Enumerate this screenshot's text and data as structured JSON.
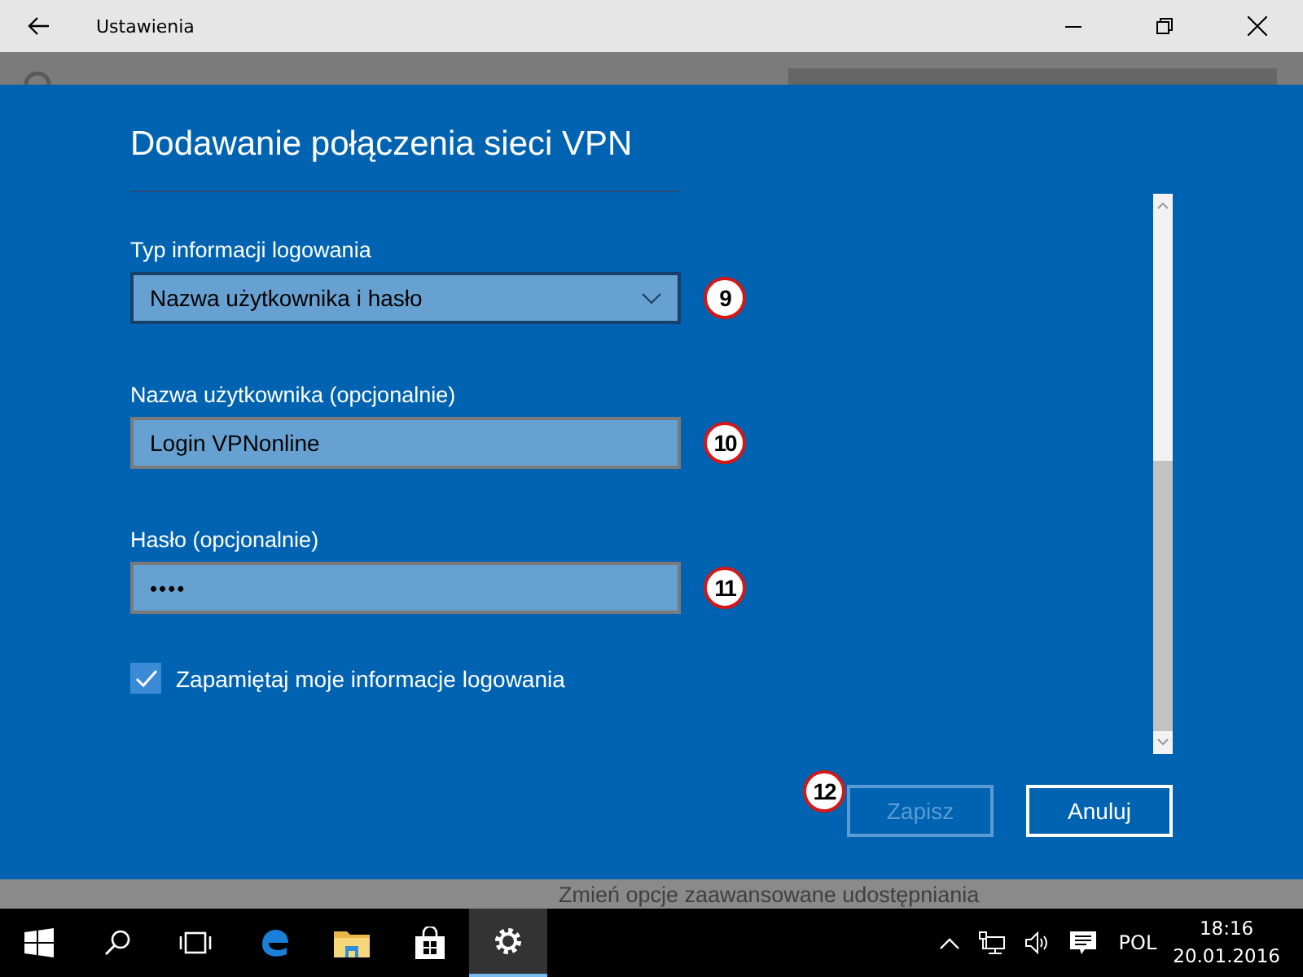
{
  "window": {
    "title": "Ustawienia"
  },
  "dialog": {
    "title": "Dodawanie połączenia sieci VPN",
    "fields": [
      {
        "kind": "dropdown",
        "label": "Typ informacji logowania",
        "value": "Nazwa użytkownika i hasło",
        "callout": "9"
      },
      {
        "kind": "text",
        "label": "Nazwa użytkownika (opcjonalnie)",
        "value": "Login VPNonline",
        "callout": "10"
      },
      {
        "kind": "password",
        "label": "Hasło (opcjonalnie)",
        "value": "••••",
        "callout": "11"
      }
    ],
    "remember": {
      "label": "Zapamiętaj moje informacje logowania",
      "checked": true
    },
    "buttons": [
      {
        "label": "Zapisz",
        "disabled": true,
        "callout": "12"
      },
      {
        "label": "Anuluj",
        "disabled": false
      }
    ]
  },
  "background_link": "Zmień opcje zaawansowane udostępniania",
  "taskbar": {
    "apps": [
      {
        "kind": "edge",
        "selected": false
      },
      {
        "kind": "explorer",
        "selected": false
      },
      {
        "kind": "store",
        "selected": false
      },
      {
        "kind": "settings",
        "selected": true
      }
    ],
    "language": "POL",
    "time": "18:16",
    "date": "20.01.2016"
  }
}
